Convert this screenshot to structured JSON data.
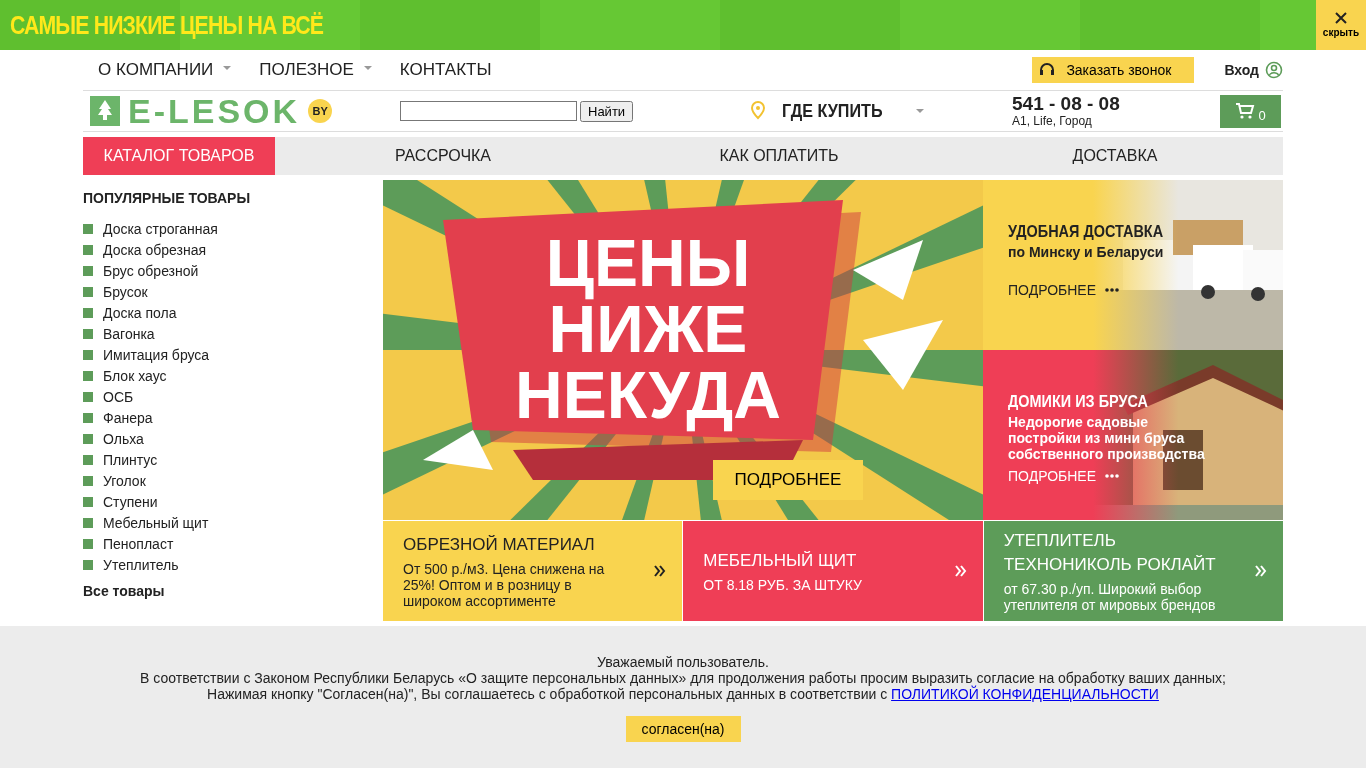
{
  "promo_bar": {
    "text": "САМЫЕ НИЗКИЕ ЦЕНЫ НА ВСЁ",
    "close_label": "скрыть"
  },
  "top_nav": [
    {
      "label": "О КОМПАНИИ",
      "has_dropdown": true
    },
    {
      "label": "ПОЛЕЗНОЕ",
      "has_dropdown": true
    },
    {
      "label": "КОНТАКТЫ",
      "has_dropdown": false
    }
  ],
  "callback_button": "Заказать звонок",
  "login": "Вход",
  "logo": {
    "text": "E-LESOK",
    "badge": "BY"
  },
  "search": {
    "button": "Найти"
  },
  "where_to_buy": "ГДЕ КУПИТЬ",
  "phone": {
    "number": "541 - 08 - 08",
    "operators": "A1, Life, Город"
  },
  "cart": {
    "count": "0"
  },
  "main_menu": [
    {
      "label": "КАТАЛОГ ТОВАРОВ",
      "selected": true
    },
    {
      "label": "РАССРОЧКА",
      "selected": false
    },
    {
      "label": "КАК ОПЛАТИТЬ",
      "selected": false
    },
    {
      "label": "ДОСТАВКА",
      "selected": false
    }
  ],
  "sidebar": {
    "title": "ПОПУЛЯРНЫЕ ТОВАРЫ",
    "items": [
      "Доска строганная",
      "Доска обрезная",
      "Брус обрезной",
      "Брусок",
      "Доска пола",
      "Вагонка",
      "Имитация бруса",
      "Блок хаус",
      "ОСБ",
      "Фанера",
      "Ольха",
      "Плинтус",
      "Уголок",
      "Ступени",
      "Мебельный щит",
      "Пенопласт",
      "Утеплитель"
    ],
    "all_link": "Все товары"
  },
  "hero": {
    "headline": [
      "ЦЕНЫ",
      "НИЖЕ",
      "НЕКУДА"
    ],
    "button": "ПОДРОБНЕЕ"
  },
  "side_cards": [
    {
      "kind": "delivery",
      "title": "УДОБНАЯ ДОСТАВКА",
      "subtitle": "по Минску и Беларуси",
      "link": "ПОДРОБНЕЕ",
      "color": "#f9d44f"
    },
    {
      "kind": "house",
      "title": "ДОМИКИ ИЗ БРУСА",
      "subtitle": "Недорогие садовые постройки из мини бруса собственного производства",
      "link": "ПОДРОБНЕЕ",
      "color": "#ef3e56"
    }
  ],
  "tiles": [
    {
      "title": "ОБРЕЗНОЙ МАТЕРИАЛ",
      "text": "От 500 р./м3. Цена снижена на 25%! Оптом и в розницу в широком ассортименте",
      "color": "#f9d44f"
    },
    {
      "title": "МЕБЕЛЬНЫЙ ЩИТ",
      "text": "ОТ 8.18 РУБ. ЗА ШТУКУ",
      "color": "#ef3e56"
    },
    {
      "title": "УТЕПЛИТЕЛЬ ТЕХНОНИКОЛЬ РОКЛАЙТ",
      "text": "от 67.30 р./уп. Широкий выбор утеплителя от мировых брендов",
      "color": "#5d9c59"
    }
  ],
  "cookie_notice": {
    "lines": [
      "Уважаемый пользователь.",
      "В соответствии с Законом Республики Беларусь «О защите персональных данных» для продолжения работы просим выразить согласие на обработку ваших данных;",
      "Нажимая кнопку \"Согласен(на)\", Вы соглашаетесь с обработкой персональных данных в соответствии с"
    ],
    "policy_link": "ПОЛИТИКОЙ КОНФИДЕНЦИАЛЬНОСТИ",
    "button": "согласен(на)"
  }
}
